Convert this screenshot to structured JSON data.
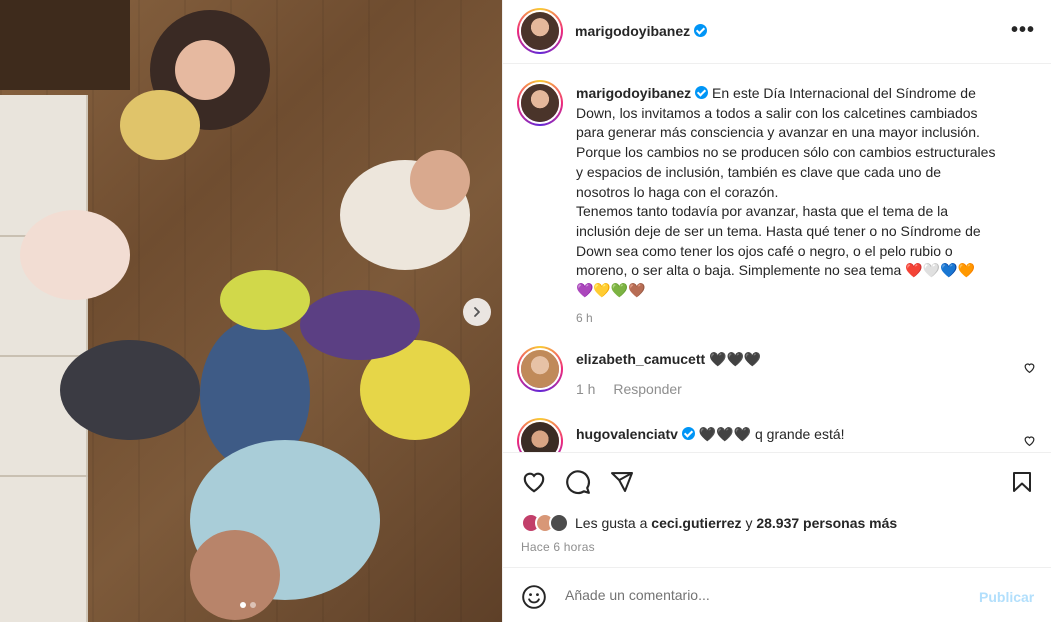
{
  "post": {
    "username": "marigodoyibanez",
    "verified": true,
    "more_label": "•••",
    "image_alt": "Photo of a family sitting in a circle on a wooden floor with mismatched socks",
    "carousel_next_icon": "chevron-right-icon",
    "carousel_dots": 2
  },
  "caption": {
    "username": "marigodoyibanez",
    "lines": [
      "En este Día Internacional del Síndrome de",
      "Down, los invitamos a todos a salir con los calcetines cambiados",
      "para generar más consciencia y avanzar en una mayor inclusión.",
      "Porque los cambios no se producen sólo con cambios estructurales",
      "y espacios de inclusión, también es clave que cada uno de",
      "nosotros lo haga con el corazón.",
      "Tenemos tanto todavía por avanzar, hasta que el tema de la",
      "inclusión deje de ser un tema. Hasta qué tener o no Síndrome de",
      "Down sea como tener los ojos café o negro, o el pelo rubio o",
      "moreno, o ser alta o baja. Simplemente no sea tema ❤️🤍💙🧡",
      "💜💛💚🤎"
    ],
    "time": "6 h"
  },
  "comments": [
    {
      "username": "elizabeth_camucett",
      "verified": false,
      "text": "🖤🖤🖤",
      "time": "1 h",
      "reply_label": "Responder"
    },
    {
      "username": "hugovalenciatv",
      "verified": true,
      "text": "🖤🖤🖤 q grande está!"
    }
  ],
  "likes": {
    "prefix": "Les gusta a",
    "user": "ceci.gutierrez",
    "connector": "y",
    "count": "28.937 personas más"
  },
  "posted_ago": "Hace 6 horas",
  "add_comment": {
    "placeholder": "Añade un comentario...",
    "publish_label": "Publicar"
  },
  "colors": {
    "accent": "#0095f6",
    "publish_disabled": "#b2dffc",
    "text": "#262626",
    "muted": "#8e8e8e"
  }
}
